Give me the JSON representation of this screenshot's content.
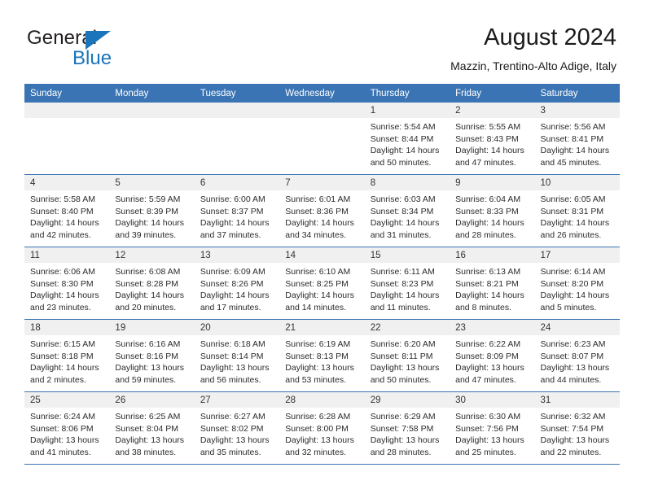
{
  "brand": {
    "name_part1": "General",
    "name_part2": "Blue",
    "accent_color": "#1b75bb"
  },
  "header": {
    "title": "August 2024",
    "location": "Mazzin, Trentino-Alto Adige, Italy"
  },
  "calendar": {
    "header_color": "#3a74b4",
    "weekday_headers": [
      "Sunday",
      "Monday",
      "Tuesday",
      "Wednesday",
      "Thursday",
      "Friday",
      "Saturday"
    ],
    "weeks": [
      [
        {
          "day": "",
          "sunrise": "",
          "sunset": "",
          "daylight_line1": "",
          "daylight_line2": ""
        },
        {
          "day": "",
          "sunrise": "",
          "sunset": "",
          "daylight_line1": "",
          "daylight_line2": ""
        },
        {
          "day": "",
          "sunrise": "",
          "sunset": "",
          "daylight_line1": "",
          "daylight_line2": ""
        },
        {
          "day": "",
          "sunrise": "",
          "sunset": "",
          "daylight_line1": "",
          "daylight_line2": ""
        },
        {
          "day": "1",
          "sunrise": "Sunrise: 5:54 AM",
          "sunset": "Sunset: 8:44 PM",
          "daylight_line1": "Daylight: 14 hours",
          "daylight_line2": "and 50 minutes."
        },
        {
          "day": "2",
          "sunrise": "Sunrise: 5:55 AM",
          "sunset": "Sunset: 8:43 PM",
          "daylight_line1": "Daylight: 14 hours",
          "daylight_line2": "and 47 minutes."
        },
        {
          "day": "3",
          "sunrise": "Sunrise: 5:56 AM",
          "sunset": "Sunset: 8:41 PM",
          "daylight_line1": "Daylight: 14 hours",
          "daylight_line2": "and 45 minutes."
        }
      ],
      [
        {
          "day": "4",
          "sunrise": "Sunrise: 5:58 AM",
          "sunset": "Sunset: 8:40 PM",
          "daylight_line1": "Daylight: 14 hours",
          "daylight_line2": "and 42 minutes."
        },
        {
          "day": "5",
          "sunrise": "Sunrise: 5:59 AM",
          "sunset": "Sunset: 8:39 PM",
          "daylight_line1": "Daylight: 14 hours",
          "daylight_line2": "and 39 minutes."
        },
        {
          "day": "6",
          "sunrise": "Sunrise: 6:00 AM",
          "sunset": "Sunset: 8:37 PM",
          "daylight_line1": "Daylight: 14 hours",
          "daylight_line2": "and 37 minutes."
        },
        {
          "day": "7",
          "sunrise": "Sunrise: 6:01 AM",
          "sunset": "Sunset: 8:36 PM",
          "daylight_line1": "Daylight: 14 hours",
          "daylight_line2": "and 34 minutes."
        },
        {
          "day": "8",
          "sunrise": "Sunrise: 6:03 AM",
          "sunset": "Sunset: 8:34 PM",
          "daylight_line1": "Daylight: 14 hours",
          "daylight_line2": "and 31 minutes."
        },
        {
          "day": "9",
          "sunrise": "Sunrise: 6:04 AM",
          "sunset": "Sunset: 8:33 PM",
          "daylight_line1": "Daylight: 14 hours",
          "daylight_line2": "and 28 minutes."
        },
        {
          "day": "10",
          "sunrise": "Sunrise: 6:05 AM",
          "sunset": "Sunset: 8:31 PM",
          "daylight_line1": "Daylight: 14 hours",
          "daylight_line2": "and 26 minutes."
        }
      ],
      [
        {
          "day": "11",
          "sunrise": "Sunrise: 6:06 AM",
          "sunset": "Sunset: 8:30 PM",
          "daylight_line1": "Daylight: 14 hours",
          "daylight_line2": "and 23 minutes."
        },
        {
          "day": "12",
          "sunrise": "Sunrise: 6:08 AM",
          "sunset": "Sunset: 8:28 PM",
          "daylight_line1": "Daylight: 14 hours",
          "daylight_line2": "and 20 minutes."
        },
        {
          "day": "13",
          "sunrise": "Sunrise: 6:09 AM",
          "sunset": "Sunset: 8:26 PM",
          "daylight_line1": "Daylight: 14 hours",
          "daylight_line2": "and 17 minutes."
        },
        {
          "day": "14",
          "sunrise": "Sunrise: 6:10 AM",
          "sunset": "Sunset: 8:25 PM",
          "daylight_line1": "Daylight: 14 hours",
          "daylight_line2": "and 14 minutes."
        },
        {
          "day": "15",
          "sunrise": "Sunrise: 6:11 AM",
          "sunset": "Sunset: 8:23 PM",
          "daylight_line1": "Daylight: 14 hours",
          "daylight_line2": "and 11 minutes."
        },
        {
          "day": "16",
          "sunrise": "Sunrise: 6:13 AM",
          "sunset": "Sunset: 8:21 PM",
          "daylight_line1": "Daylight: 14 hours",
          "daylight_line2": "and 8 minutes."
        },
        {
          "day": "17",
          "sunrise": "Sunrise: 6:14 AM",
          "sunset": "Sunset: 8:20 PM",
          "daylight_line1": "Daylight: 14 hours",
          "daylight_line2": "and 5 minutes."
        }
      ],
      [
        {
          "day": "18",
          "sunrise": "Sunrise: 6:15 AM",
          "sunset": "Sunset: 8:18 PM",
          "daylight_line1": "Daylight: 14 hours",
          "daylight_line2": "and 2 minutes."
        },
        {
          "day": "19",
          "sunrise": "Sunrise: 6:16 AM",
          "sunset": "Sunset: 8:16 PM",
          "daylight_line1": "Daylight: 13 hours",
          "daylight_line2": "and 59 minutes."
        },
        {
          "day": "20",
          "sunrise": "Sunrise: 6:18 AM",
          "sunset": "Sunset: 8:14 PM",
          "daylight_line1": "Daylight: 13 hours",
          "daylight_line2": "and 56 minutes."
        },
        {
          "day": "21",
          "sunrise": "Sunrise: 6:19 AM",
          "sunset": "Sunset: 8:13 PM",
          "daylight_line1": "Daylight: 13 hours",
          "daylight_line2": "and 53 minutes."
        },
        {
          "day": "22",
          "sunrise": "Sunrise: 6:20 AM",
          "sunset": "Sunset: 8:11 PM",
          "daylight_line1": "Daylight: 13 hours",
          "daylight_line2": "and 50 minutes."
        },
        {
          "day": "23",
          "sunrise": "Sunrise: 6:22 AM",
          "sunset": "Sunset: 8:09 PM",
          "daylight_line1": "Daylight: 13 hours",
          "daylight_line2": "and 47 minutes."
        },
        {
          "day": "24",
          "sunrise": "Sunrise: 6:23 AM",
          "sunset": "Sunset: 8:07 PM",
          "daylight_line1": "Daylight: 13 hours",
          "daylight_line2": "and 44 minutes."
        }
      ],
      [
        {
          "day": "25",
          "sunrise": "Sunrise: 6:24 AM",
          "sunset": "Sunset: 8:06 PM",
          "daylight_line1": "Daylight: 13 hours",
          "daylight_line2": "and 41 minutes."
        },
        {
          "day": "26",
          "sunrise": "Sunrise: 6:25 AM",
          "sunset": "Sunset: 8:04 PM",
          "daylight_line1": "Daylight: 13 hours",
          "daylight_line2": "and 38 minutes."
        },
        {
          "day": "27",
          "sunrise": "Sunrise: 6:27 AM",
          "sunset": "Sunset: 8:02 PM",
          "daylight_line1": "Daylight: 13 hours",
          "daylight_line2": "and 35 minutes."
        },
        {
          "day": "28",
          "sunrise": "Sunrise: 6:28 AM",
          "sunset": "Sunset: 8:00 PM",
          "daylight_line1": "Daylight: 13 hours",
          "daylight_line2": "and 32 minutes."
        },
        {
          "day": "29",
          "sunrise": "Sunrise: 6:29 AM",
          "sunset": "Sunset: 7:58 PM",
          "daylight_line1": "Daylight: 13 hours",
          "daylight_line2": "and 28 minutes."
        },
        {
          "day": "30",
          "sunrise": "Sunrise: 6:30 AM",
          "sunset": "Sunset: 7:56 PM",
          "daylight_line1": "Daylight: 13 hours",
          "daylight_line2": "and 25 minutes."
        },
        {
          "day": "31",
          "sunrise": "Sunrise: 6:32 AM",
          "sunset": "Sunset: 7:54 PM",
          "daylight_line1": "Daylight: 13 hours",
          "daylight_line2": "and 22 minutes."
        }
      ]
    ]
  }
}
